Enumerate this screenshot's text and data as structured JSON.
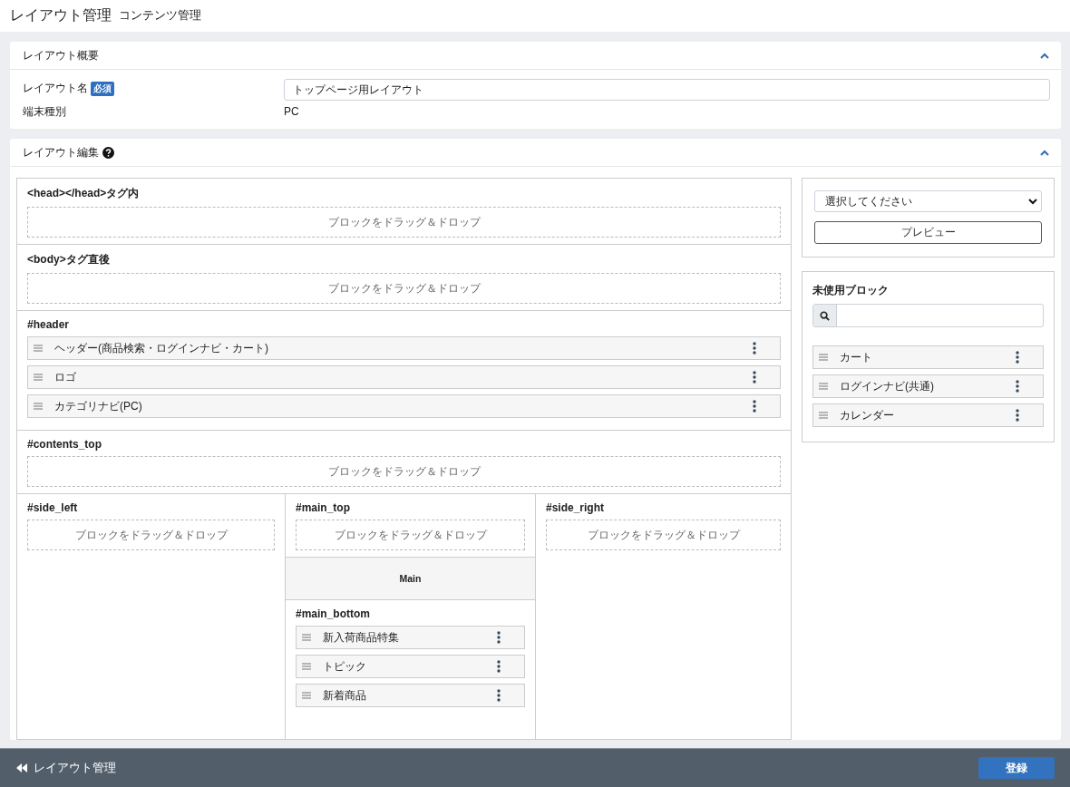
{
  "header": {
    "title": "レイアウト管理",
    "subtitle": "コンテンツ管理"
  },
  "overview": {
    "title": "レイアウト概要",
    "expanded": true,
    "name_label": "レイアウト名",
    "required_badge": "必須",
    "name_value": "トップページ用レイアウト",
    "device_label": "端末種別",
    "device_value": "PC"
  },
  "editor": {
    "title": "レイアウト編集",
    "expanded": true,
    "top_sections": [
      {
        "title": "<head></head>タグ内",
        "kind": "drop",
        "drop_text": "ブロックをドラッグ＆ドロップ"
      },
      {
        "title": "<body>タグ直後",
        "kind": "drop",
        "drop_text": "ブロックをドラッグ＆ドロップ"
      },
      {
        "title": "#header",
        "kind": "blocks",
        "blocks": [
          "ヘッダー(商品検索・ログインナビ・カート)",
          "ロゴ",
          "カテゴリナビ(PC)"
        ]
      },
      {
        "title": "#contents_top",
        "kind": "drop",
        "drop_text": "ブロックをドラッグ＆ドロップ"
      }
    ],
    "columns": [
      {
        "sections": [
          {
            "title": "#side_left",
            "kind": "drop",
            "drop_text": "ブロックをドラッグ＆ドロップ"
          }
        ]
      },
      {
        "sections": [
          {
            "title": "#main_top",
            "kind": "drop",
            "drop_text": "ブロックをドラッグ＆ドロップ"
          },
          {
            "title": "Main",
            "kind": "main"
          },
          {
            "title": "#main_bottom",
            "kind": "blocks",
            "blocks": [
              "新入荷商品特集",
              "トピック",
              "新着商品"
            ]
          }
        ]
      },
      {
        "sections": [
          {
            "title": "#side_right",
            "kind": "drop",
            "drop_text": "ブロックをドラッグ＆ドロップ"
          }
        ]
      }
    ]
  },
  "preview": {
    "select_value": "選択してください",
    "button": "プレビュー"
  },
  "unused": {
    "title": "未使用ブロック",
    "blocks": [
      "カート",
      "ログインナビ(共通)",
      "カレンダー"
    ]
  },
  "footer": {
    "back_label": "レイアウト管理",
    "save_button": "登録"
  }
}
